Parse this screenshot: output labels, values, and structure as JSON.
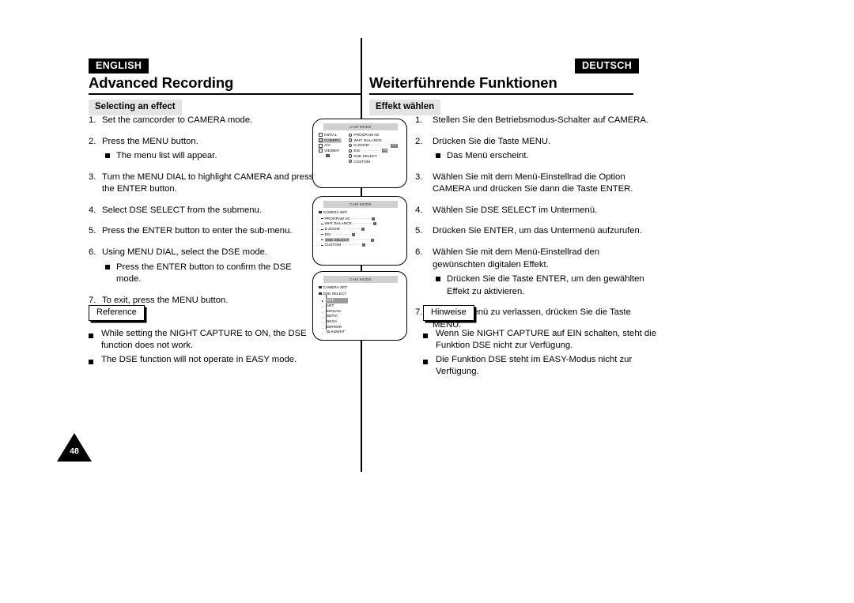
{
  "page": {
    "number": "48"
  },
  "english": {
    "lang_tag": "ENGLISH",
    "chapter_title": "Advanced Recording",
    "section_title": "Selecting an effect",
    "steps": [
      {
        "num": "1.",
        "text": "Set the camcorder to CAMERA mode."
      },
      {
        "num": "2.",
        "text": "Press the MENU button.",
        "sub": "The menu list will appear."
      },
      {
        "num": "3.",
        "text": "Turn the MENU DIAL to highlight CAMERA and press the ENTER button."
      },
      {
        "num": "4.",
        "text": "Select DSE SELECT from the submenu."
      },
      {
        "num": "5.",
        "text": "Press the ENTER button to enter the sub-menu."
      },
      {
        "num": "6.",
        "text": "Using MENU DIAL, select the DSE mode.",
        "sub": "Press the ENTER button to confirm the DSE mode."
      },
      {
        "num": "7.",
        "text": "To exit, press the MENU button."
      }
    ],
    "note_label": "Reference",
    "notes": [
      "While setting the NIGHT CAPTURE to ON, the DSE function does not work.",
      "The DSE function will not operate in EASY mode."
    ]
  },
  "german": {
    "lang_tag": "DEUTSCH",
    "chapter_title": "Weiterführende Funktionen",
    "section_title": "Effekt wählen",
    "steps": [
      {
        "num": "1.",
        "text": "Stellen Sie den Betriebsmodus-Schalter auf CAMERA."
      },
      {
        "num": "2.",
        "text": "Drücken Sie die Taste MENU.",
        "sub": "Das Menü erscheint."
      },
      {
        "num": "3.",
        "text": "Wählen Sie mit dem Menü-Einstellrad die Option CAMERA und drücken Sie dann die Taste ENTER."
      },
      {
        "num": "4.",
        "text": "Wählen Sie DSE SELECT im Untermenü."
      },
      {
        "num": "5.",
        "text": "Drücken Sie ENTER, um das Untermenü aufzurufen."
      },
      {
        "num": "6.",
        "text": "Wählen Sie mit dem Menü-Einstellrad den gewünschten digitalen Effekt.",
        "sub": "Drücken Sie die Taste ENTER, um den gewählten Effekt zu aktivieren."
      },
      {
        "num": "7.",
        "text": "Um das Menü zu verlassen, drücken Sie die Taste MENU."
      }
    ],
    "note_label": "Hinweise",
    "notes": [
      "Wenn Sie NIGHT CAPTURE auf EIN schalten, steht die Funktion DSE nicht zur Verfügung.",
      "Die Funktion DSE steht im EASY-Modus nicht zur Verfügung."
    ]
  },
  "screens": [
    {
      "title": "CAM MODE",
      "left_items": [
        {
          "label": "INITIAL",
          "highlighted": false
        },
        {
          "label": "CAMERA",
          "highlighted": true
        },
        {
          "label": "A/V",
          "highlighted": false
        },
        {
          "label": "VIEWER",
          "highlighted": false
        }
      ],
      "right_items": [
        {
          "label": "PROGRAM AE",
          "value": ""
        },
        {
          "label": "WHT. BALANCE",
          "value": ""
        },
        {
          "label": "D.ZOOM",
          "value": "OFF"
        },
        {
          "label": "EIS",
          "value": "ON"
        },
        {
          "label": "DSE SELECT",
          "value": ""
        },
        {
          "label": "CUSTOM",
          "value": ""
        }
      ]
    },
    {
      "title": "CAM MODE",
      "heading": "CAMERA SET",
      "items": [
        {
          "label": "PROGRAM AE",
          "highlighted": false
        },
        {
          "label": "WHT BALANCE",
          "highlighted": false
        },
        {
          "label": "D ZOOM",
          "highlighted": false
        },
        {
          "label": "EIS",
          "highlighted": false
        },
        {
          "label": "DSE SELECT",
          "highlighted": true
        },
        {
          "label": "CUSTOM",
          "highlighted": false
        }
      ]
    },
    {
      "title": "CAM MODE",
      "heading": "CAMERA SET",
      "subheading": "DSE SELECT",
      "options": [
        {
          "label": "OFF",
          "highlighted": true
        },
        {
          "label": "ART",
          "highlighted": false
        },
        {
          "label": "MOSAIC",
          "highlighted": false
        },
        {
          "label": "SEPIA",
          "highlighted": false
        },
        {
          "label": "NEGA",
          "highlighted": false
        },
        {
          "label": "MIRROR",
          "highlighted": false
        },
        {
          "label": "BLK&WHT",
          "highlighted": false
        }
      ]
    }
  ]
}
